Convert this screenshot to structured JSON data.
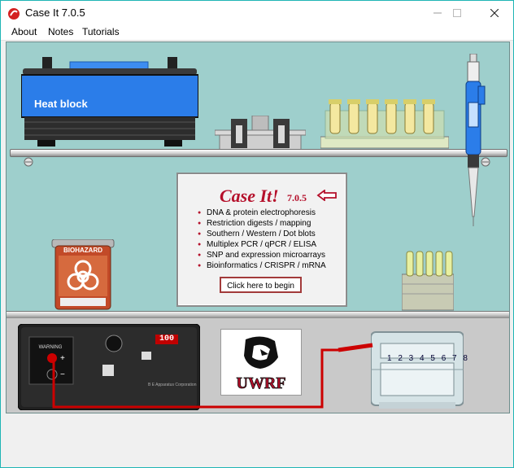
{
  "window": {
    "title": "Case It 7.0.5"
  },
  "menu": {
    "items": [
      "About",
      "Notes",
      "Tutorials"
    ]
  },
  "bench": {
    "heat_block_label": "Heat block",
    "biohazard_label": "BIOHAZARD",
    "power_supply_display": "100",
    "gel_lane_numbers": "1 2 3 4 5 6 7 8",
    "logo_text": "UWRF"
  },
  "info_panel": {
    "app_name": "Case It!",
    "version": "7.0.5",
    "features": [
      "DNA & protein electrophoresis",
      "Restriction digests / mapping",
      "Southern / Western / Dot blots",
      "Multiplex PCR / qPCR / ELISA",
      "SNP and expression microarrays",
      "Bioinformatics / CRISPR / mRNA"
    ],
    "begin_button": "Click here to begin"
  },
  "colors": {
    "desktop": "#1fb5b5",
    "bench_background": "#9ecfcc",
    "accent_red": "#b5102b",
    "heat_block_blue": "#2b7de9"
  }
}
